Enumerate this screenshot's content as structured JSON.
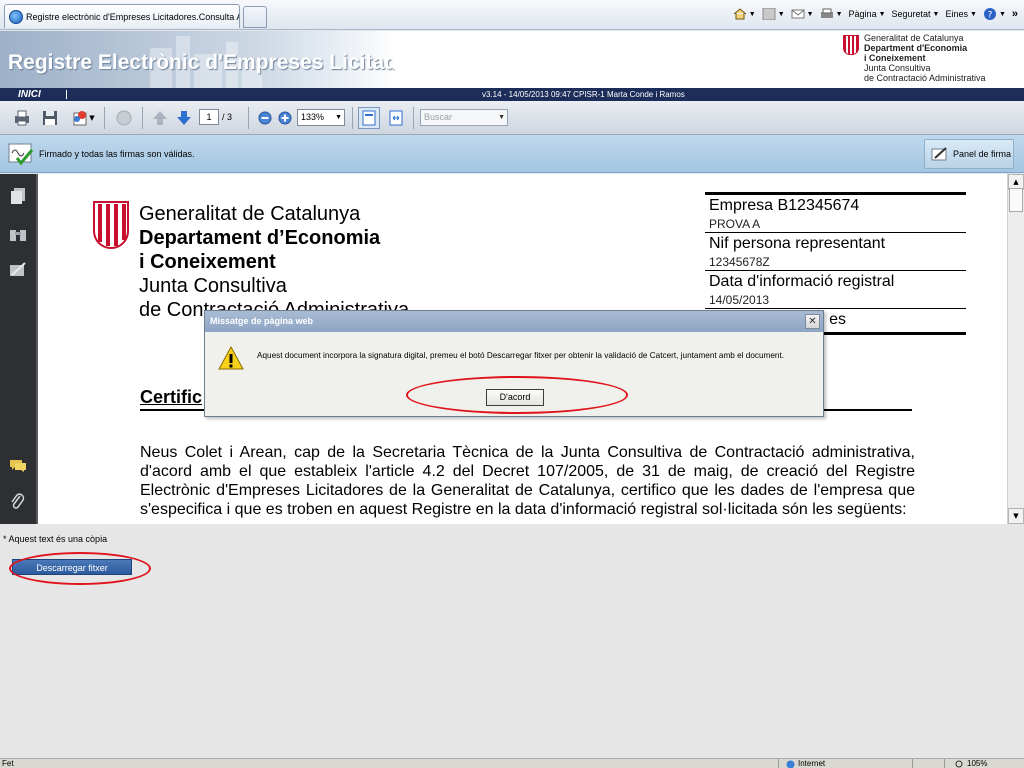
{
  "browser": {
    "tab_title": "Registre electrònic d'Empreses Licitadores.Consulta A...",
    "commands": {
      "page": "Pàgina",
      "security": "Seguretat",
      "tools": "Eines",
      "more": "»"
    }
  },
  "header": {
    "banner_title": "Registre Electrònic d'Empreses Licitadores",
    "logo_lines": [
      "Generalitat de Catalunya",
      "Department d'Economia",
      "i Coneixement",
      "Junta Consultiva",
      "de Contractació Administrativa"
    ]
  },
  "nav": {
    "inici": "INICI",
    "version": "v3.14 - 14/05/2013 09:47 CPISR-1 Marta Conde i Ramos"
  },
  "pdf_toolbar": {
    "page_current": "1",
    "page_total": "/ 3",
    "zoom": "133%",
    "search_placeholder": "Buscar"
  },
  "signature": {
    "status": "Firmado y todas las firmas son válidas.",
    "panel_button": "Panel de firma"
  },
  "document": {
    "dept_lines": [
      "Generalitat de Catalunya",
      "Departament d’Economia",
      "i Coneixement",
      "Junta Consultiva",
      "de Contractació Administrativa"
    ],
    "box": [
      {
        "label": "Empresa B12345674",
        "value": "PROVA A"
      },
      {
        "label": "Nif persona representant",
        "value": "12345678Z"
      },
      {
        "label": "Data d'informació registral",
        "value": "14/05/2013"
      },
      {
        "label": "es",
        "value": ""
      }
    ],
    "heading": "Certific",
    "body": "Neus Colet i Arean, cap de la Secretaria Tècnica de la Junta Consultiva de Contractació administrativa, d'acord amb el que estableix l'article 4.2 del Decret 107/2005, de 31 de maig, de creació del Registre Electrònic d'Empreses Licitadores de la Generalitat de Catalunya, certifico que les dades de l'empresa que s'especifica i que es troben en aquest Registre en la data d'informació registral sol·licitada són les següents:"
  },
  "below": {
    "copy_note": "* Aquest text és una còpia",
    "download_button": "Descarregar fitxer"
  },
  "modal": {
    "title": "Missatge de pàgina web",
    "message": "Aquest document incorpora la signatura digital, premeu el botó Descarregar fitxer per obtenir la validació de Catcert, juntament amb el document.",
    "ok_button": "D'acord",
    "close_glyph": "✕"
  },
  "status_bar": {
    "left": "Fet",
    "zone": "Internet",
    "zoom": "105%"
  },
  "colors": {
    "annotation": "#e0141c",
    "nav_strip": "#1c2d5a",
    "gencat_red": "#c8102e"
  }
}
